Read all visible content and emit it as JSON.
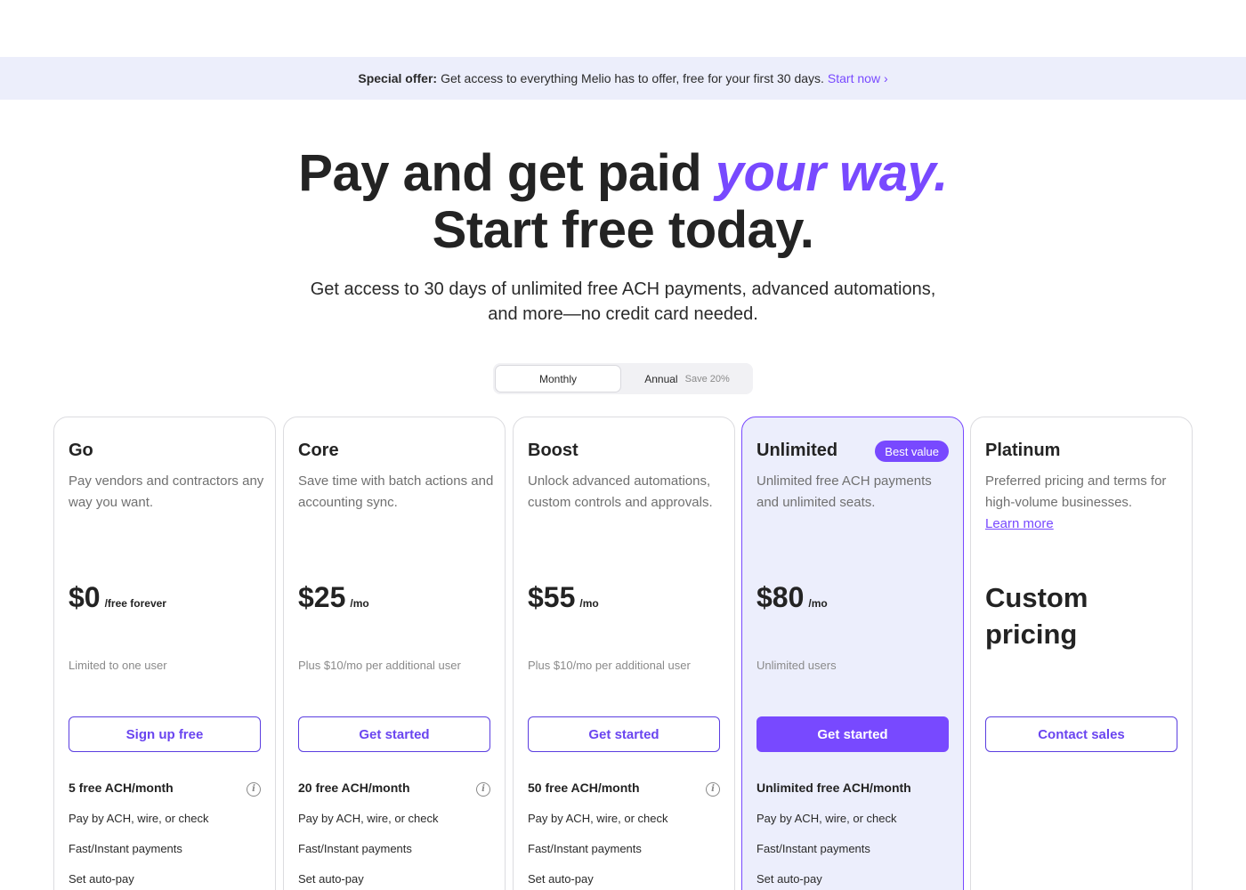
{
  "promo": {
    "bold": "Special offer:",
    "text": "Get access to everything Melio has to offer, free for your first 30 days.",
    "link": "Start now ›"
  },
  "hero": {
    "title_part1": "Pay and get paid ",
    "title_accent": "your way.",
    "title_line2": "Start free today.",
    "subtitle_line1": "Get access to 30 days of unlimited free ACH payments, advanced automations,",
    "subtitle_line2": "and more—no credit card needed."
  },
  "billing_toggle": {
    "monthly": "Monthly",
    "annual": "Annual",
    "annual_save": "Save 20%"
  },
  "plans": [
    {
      "name": "Go",
      "description": "Pay vendors and contractors any way you want.",
      "price": "$0",
      "period": "/free forever",
      "note": "Limited to one user",
      "cta": "Sign up free",
      "feature_head": "5 free ACH/month",
      "features": [
        "Pay by ACH, wire, or check",
        "Fast/Instant payments",
        "Set auto-pay"
      ]
    },
    {
      "name": "Core",
      "description": "Save time with batch actions and accounting sync.",
      "price": "$25",
      "period": "/mo",
      "note": "Plus $10/mo per additional user",
      "cta": "Get started",
      "feature_head": "20 free ACH/month",
      "features": [
        "Pay by ACH, wire, or check",
        "Fast/Instant payments",
        "Set auto-pay"
      ]
    },
    {
      "name": "Boost",
      "description": "Unlock advanced automations, custom controls and approvals.",
      "price": "$55",
      "period": "/mo",
      "note": "Plus $10/mo per additional user",
      "cta": "Get started",
      "feature_head": "50 free ACH/month",
      "features": [
        "Pay by ACH, wire, or check",
        "Fast/Instant payments",
        "Set auto-pay"
      ]
    },
    {
      "name": "Unlimited",
      "badge": "Best value",
      "description": "Unlimited free ACH payments and unlimited seats.",
      "price": "$80",
      "period": "/mo",
      "note": "Unlimited users",
      "cta": "Get started",
      "feature_head": "Unlimited free ACH/month",
      "features": [
        "Pay by ACH, wire, or check",
        "Fast/Instant payments",
        "Set auto-pay"
      ]
    },
    {
      "name": "Platinum",
      "description": "Preferred pricing and terms for high-volume businesses.",
      "learn_more": "Learn more",
      "custom_price_line1": "Custom",
      "custom_price_line2": "pricing",
      "cta": "Contact sales"
    }
  ],
  "colors": {
    "accent": "#7849ff",
    "promo_bg": "#eceefb",
    "featured_bg": "#eceefc"
  }
}
